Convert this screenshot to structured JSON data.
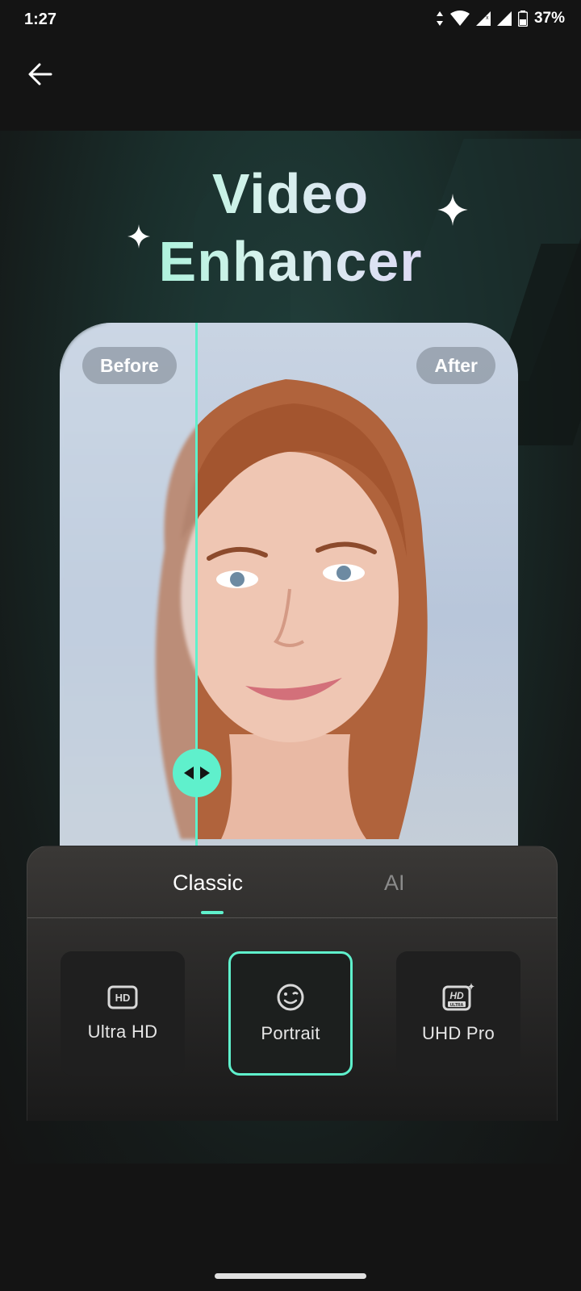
{
  "status_bar": {
    "time": "1:27",
    "battery_percent": "37%",
    "icons": [
      "data-arrows-icon",
      "wifi-icon",
      "signal-icon",
      "signal-icon",
      "battery-icon"
    ]
  },
  "header": {
    "back_icon": "arrow-left-icon"
  },
  "hero": {
    "title_line_1": "Video",
    "title_line_2": "Enhancer",
    "accent_color": "#5ff0cc"
  },
  "compare": {
    "before_label": "Before",
    "after_label": "After",
    "handle_icon": "left-right-arrows-icon",
    "split_position": 0.3
  },
  "tabs": [
    {
      "label": "Classic",
      "selected": true
    },
    {
      "label": "AI",
      "selected": false
    }
  ],
  "options": [
    {
      "label": "Ultra HD",
      "icon": "hd-icon",
      "selected": false
    },
    {
      "label": "Portrait",
      "icon": "smiley-face-icon",
      "selected": true
    },
    {
      "label": "UHD Pro",
      "icon": "hd-ultra-icon",
      "selected": false
    }
  ]
}
